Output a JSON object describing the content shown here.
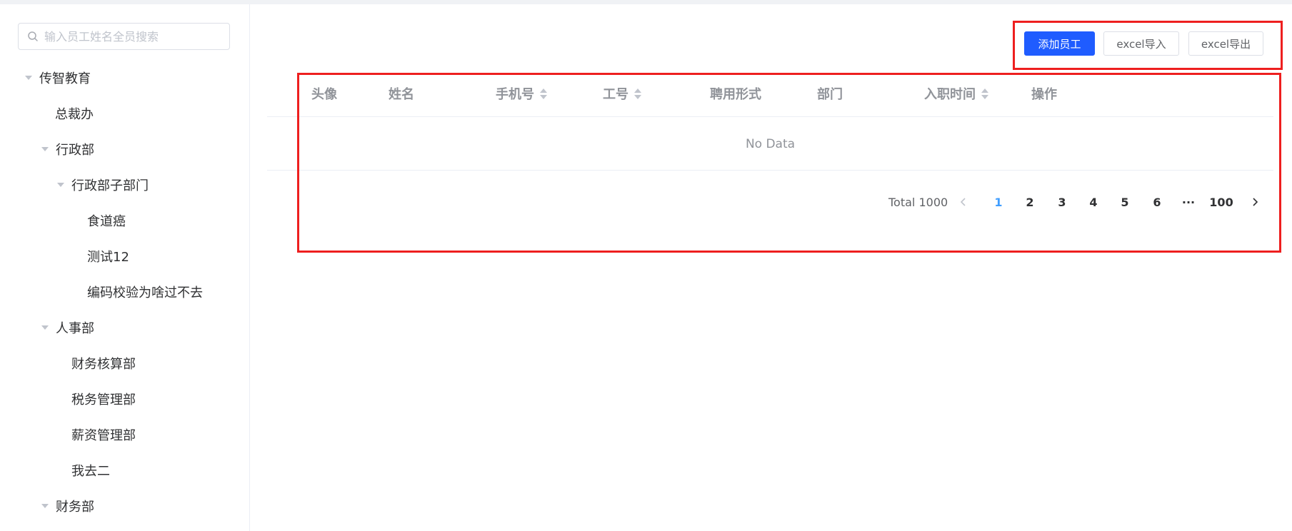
{
  "search": {
    "placeholder": "输入员工姓名全员搜索"
  },
  "tree": [
    {
      "label": "传智教育"
    },
    {
      "label": "总裁办"
    },
    {
      "label": "行政部"
    },
    {
      "label": "行政部子部门"
    },
    {
      "label": "食道癌"
    },
    {
      "label": "测试12"
    },
    {
      "label": "编码校验为啥过不去"
    },
    {
      "label": "人事部"
    },
    {
      "label": "财务核算部"
    },
    {
      "label": "税务管理部"
    },
    {
      "label": "薪资管理部"
    },
    {
      "label": "我去二"
    },
    {
      "label": "财务部"
    }
  ],
  "toolbar": {
    "add_label": "添加员工",
    "import_label": "excel导入",
    "export_label": "excel导出"
  },
  "table": {
    "columns": [
      "头像",
      "姓名",
      "手机号",
      "工号",
      "聘用形式",
      "部门",
      "入职时间",
      "操作"
    ],
    "empty_text": "No Data"
  },
  "pagination": {
    "total_text": "Total 1000",
    "pages": [
      "1",
      "2",
      "3",
      "4",
      "5",
      "6",
      "···",
      "100"
    ],
    "current": "1"
  },
  "colors": {
    "primary": "#1f5cff",
    "highlight_border": "#ee1f1f",
    "active_page": "#409eff"
  }
}
